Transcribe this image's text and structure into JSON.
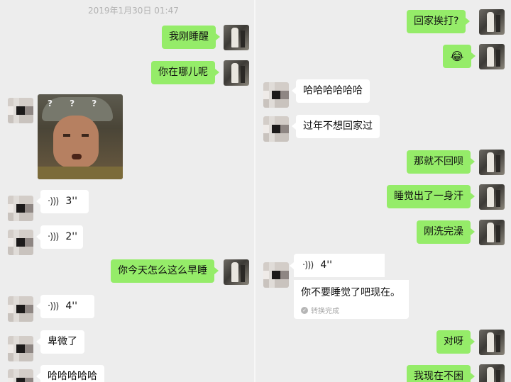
{
  "left": {
    "timestamp": "2019年1月30日 01:47",
    "messages": [
      {
        "text": "我刚睡醒"
      },
      {
        "text": "你在哪儿呢"
      },
      {
        "text": "3''"
      },
      {
        "text": "2''"
      },
      {
        "text": "你今天怎么这么早睡"
      },
      {
        "text": "4''"
      },
      {
        "text": "卑微了"
      },
      {
        "text": "哈哈哈哈哈"
      }
    ],
    "sticker_caption": "? ? ?"
  },
  "right": {
    "messages": [
      {
        "text": "回家挨打?"
      },
      {
        "text": "😂"
      },
      {
        "text": "哈哈哈哈哈哈"
      },
      {
        "text": "过年不想回家过"
      },
      {
        "text": "那就不回呗"
      },
      {
        "text": "睡觉出了一身汗"
      },
      {
        "text": "刚洗完澡"
      },
      {
        "text": "对呀"
      },
      {
        "text": "我现在不困"
      }
    ],
    "voice_card": {
      "duration": "4''",
      "converted_text": "你不要睡觉了吧现在。",
      "status": "转换完成"
    }
  },
  "icons": {
    "voice": "voice-wave-icon",
    "check": "check-circle-icon",
    "laugh_emoji": "tears-of-joy-emoji"
  },
  "colors": {
    "sent_bubble": "#95ec69",
    "received_bubble": "#ffffff",
    "background": "#ededed"
  }
}
